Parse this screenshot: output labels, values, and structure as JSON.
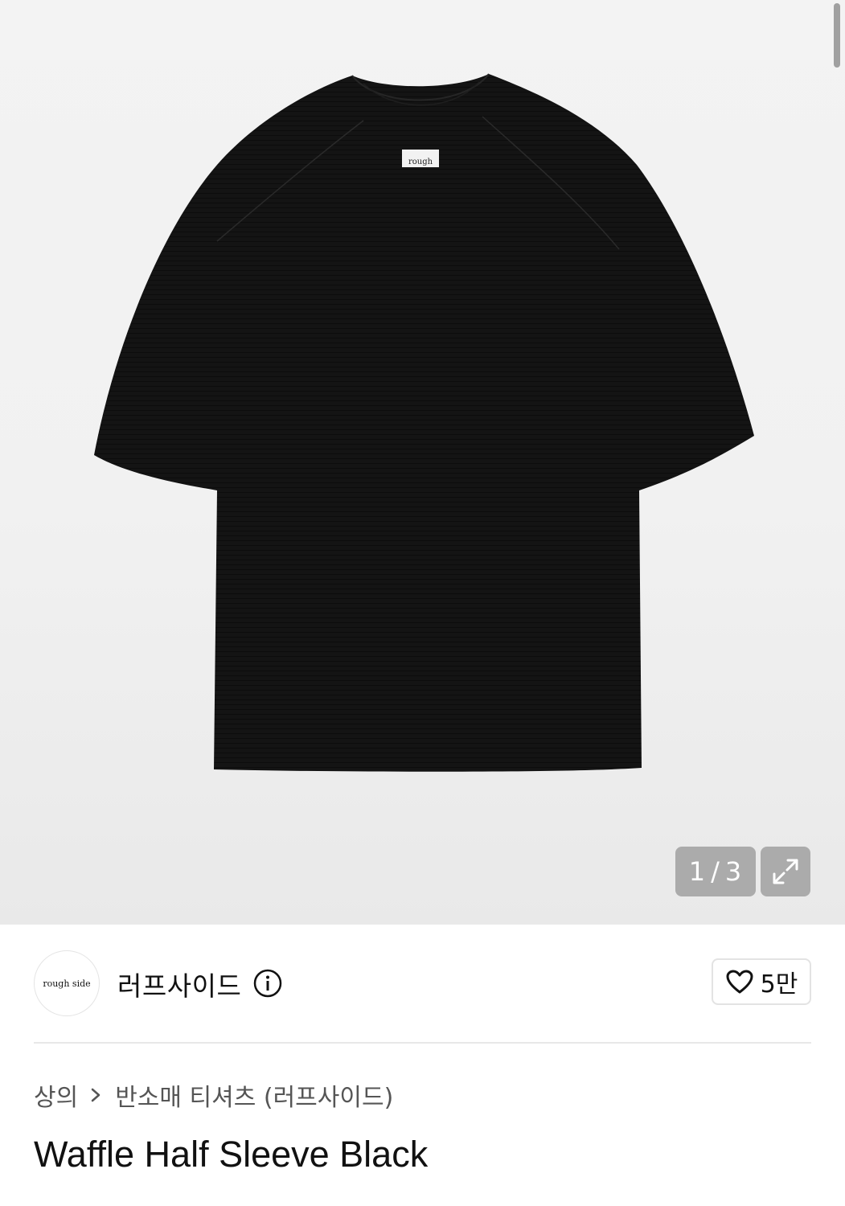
{
  "gallery": {
    "label_text": "rough",
    "counter_current": "1",
    "counter_separator": "/",
    "counter_total": "3"
  },
  "brand": {
    "logo_text": "rough side",
    "name": "러프사이드",
    "likes": "5만"
  },
  "breadcrumb": {
    "category": "상의",
    "subcategory": "반소매 티셔츠 (러프사이드)"
  },
  "product": {
    "title": "Waffle Half Sleeve Black"
  }
}
